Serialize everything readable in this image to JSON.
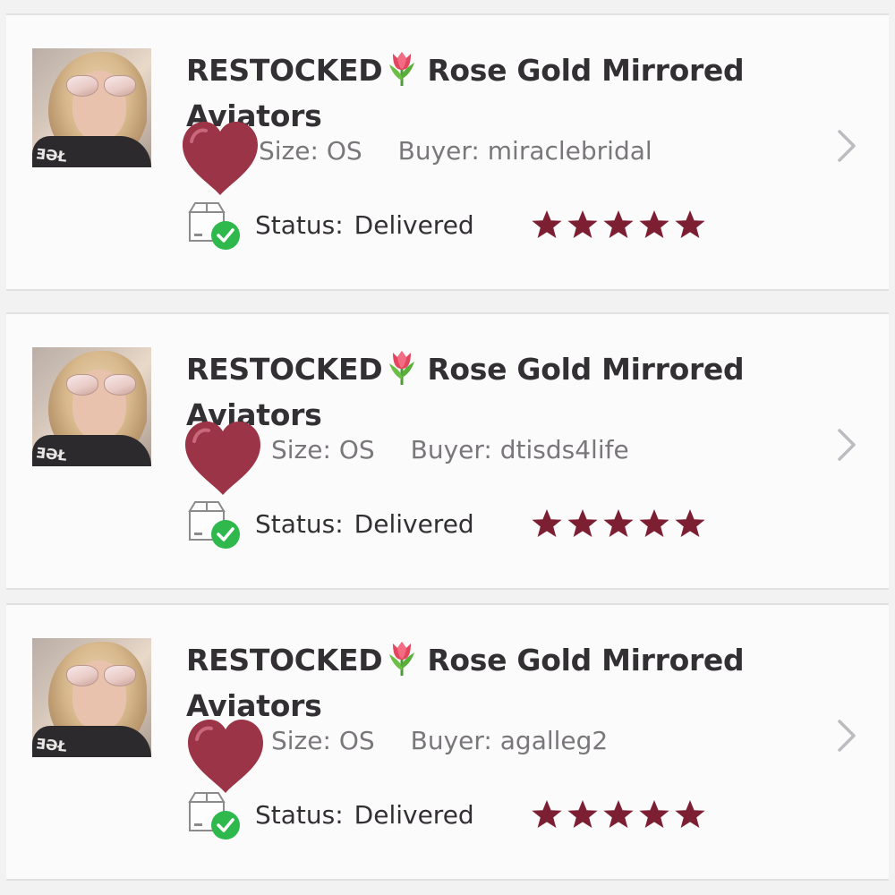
{
  "colors": {
    "accent": "#7d1f33",
    "heart": "#9b3446",
    "delivered_check": "#2fb84c",
    "title_text": "#333033",
    "meta_text": "#7a777b"
  },
  "orders": [
    {
      "title_before": "RESTOCKED",
      "title_after": "Rose Gold Mirrored Aviators",
      "size_label": "Size:",
      "size_value": "OS",
      "buyer_label": "Buyer:",
      "buyer_value": "miraclebridal",
      "status_label": "Status:",
      "status_value": "Delivered",
      "rating": 5,
      "thumb_text": "ƎƏŁ"
    },
    {
      "title_before": "RESTOCKED",
      "title_after": "Rose Gold Mirrored Aviators",
      "size_label": "Size:",
      "size_value": "OS",
      "buyer_label": "Buyer:",
      "buyer_value": "dtisds4life",
      "status_label": "Status:",
      "status_value": "Delivered",
      "rating": 5,
      "thumb_text": "ƎƏŁ"
    },
    {
      "title_before": "RESTOCKED",
      "title_after": "Rose Gold Mirrored Aviators",
      "size_label": "Size:",
      "size_value": "OS",
      "buyer_label": "Buyer:",
      "buyer_value": "agalleg2",
      "status_label": "Status:",
      "status_value": "Delivered",
      "rating": 5,
      "thumb_text": "ƎƏŁ"
    }
  ],
  "icons": {
    "title_emoji": "tulip-icon",
    "overlay": "heart-icon",
    "status": "package-delivered-icon",
    "rating": "star-icon",
    "row_action": "chevron-right-icon"
  }
}
